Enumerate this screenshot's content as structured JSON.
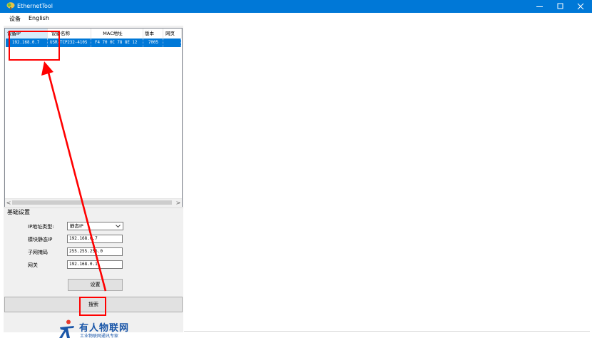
{
  "window": {
    "title": "EthernetTool",
    "app_icon": "tree-app-icon",
    "controls": [
      "minimize-icon",
      "maximize-icon",
      "close-icon"
    ]
  },
  "menubar": {
    "items": [
      "设备",
      "English"
    ]
  },
  "device_list": {
    "columns": [
      "设备IP",
      "设备名称",
      "MAC地址",
      "版本",
      "网页"
    ],
    "rows": [
      {
        "ip": "192.168.0.7",
        "name": "USR-TCP232-410S",
        "mac": "F4 70 0C 78 8E 12",
        "version": "7005",
        "web": "",
        "selected": true
      }
    ],
    "scroll_left": "<",
    "scroll_right": ">"
  },
  "settings": {
    "group_title": "基础设置",
    "ip_type_label": "IP地址类型:",
    "ip_type_value": "静态IP",
    "static_ip_label": "模块静态IP",
    "static_ip_value": "192.168.0.7",
    "subnet_label": "子网掩码",
    "subnet_value": "255.255.255.0",
    "gateway_label": "网关",
    "gateway_value": "192.168.0.1",
    "setup_button": "设置"
  },
  "search_button": "搜索",
  "logo": {
    "title": "有人物联网",
    "subtitle": "工业物联网通讯专家"
  },
  "colors": {
    "titlebar": "#0078d7",
    "selection": "#0078d7",
    "annotation": "#ff0000",
    "logo": "#1a56a8"
  }
}
